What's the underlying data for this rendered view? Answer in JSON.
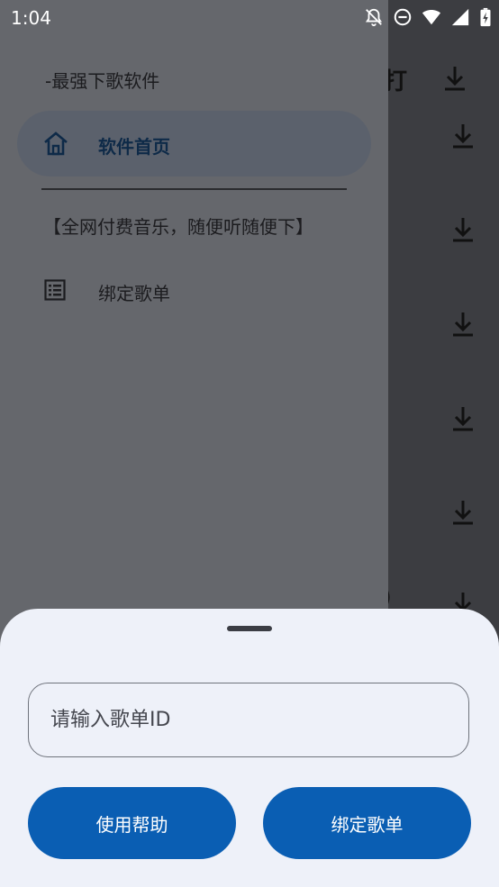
{
  "status_bar": {
    "time": "1:04",
    "icons": [
      "bell-off-icon",
      "do-not-disturb-icon",
      "wifi-icon",
      "signal-icon",
      "battery-charging-icon"
    ]
  },
  "background": {
    "top_glyph": "打",
    "partial_text": ")",
    "download_icon": "download-icon"
  },
  "drawer": {
    "subtitle": "-最强下歌软件",
    "items": [
      {
        "label": "软件首页",
        "icon": "home-icon",
        "active": true
      },
      {
        "label": "绑定歌单",
        "icon": "list-icon",
        "active": false
      }
    ],
    "note": "【全网付费音乐，随便听随便下】"
  },
  "sheet": {
    "input_placeholder": "请输入歌单ID",
    "input_value": "",
    "help_button": "使用帮助",
    "bind_button": "绑定歌单"
  },
  "colors": {
    "primary": "#0a5eb3",
    "sheet_bg": "#eef1f9",
    "drawer_bg": "#65676c"
  }
}
